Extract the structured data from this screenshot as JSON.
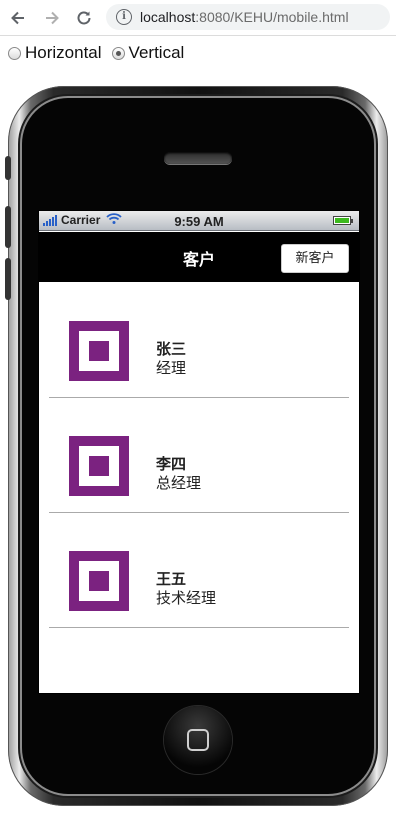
{
  "browser": {
    "url_host": "localhost",
    "url_rest": ":8080/KEHU/mobile.html"
  },
  "orientation": {
    "options": [
      {
        "label": "Horizontal",
        "checked": false
      },
      {
        "label": "Vertical",
        "checked": true
      }
    ]
  },
  "statusbar": {
    "carrier": "Carrier",
    "time": "9:59 AM"
  },
  "navbar": {
    "title": "客户",
    "new_button": "新客户"
  },
  "customers": [
    {
      "name": "张三",
      "role": "经理"
    },
    {
      "name": "李四",
      "role": "总经理"
    },
    {
      "name": "王五",
      "role": "技术经理"
    }
  ],
  "colors": {
    "avatar": "#7b2280",
    "navbar": "#000000",
    "battery": "#3cb91e"
  }
}
